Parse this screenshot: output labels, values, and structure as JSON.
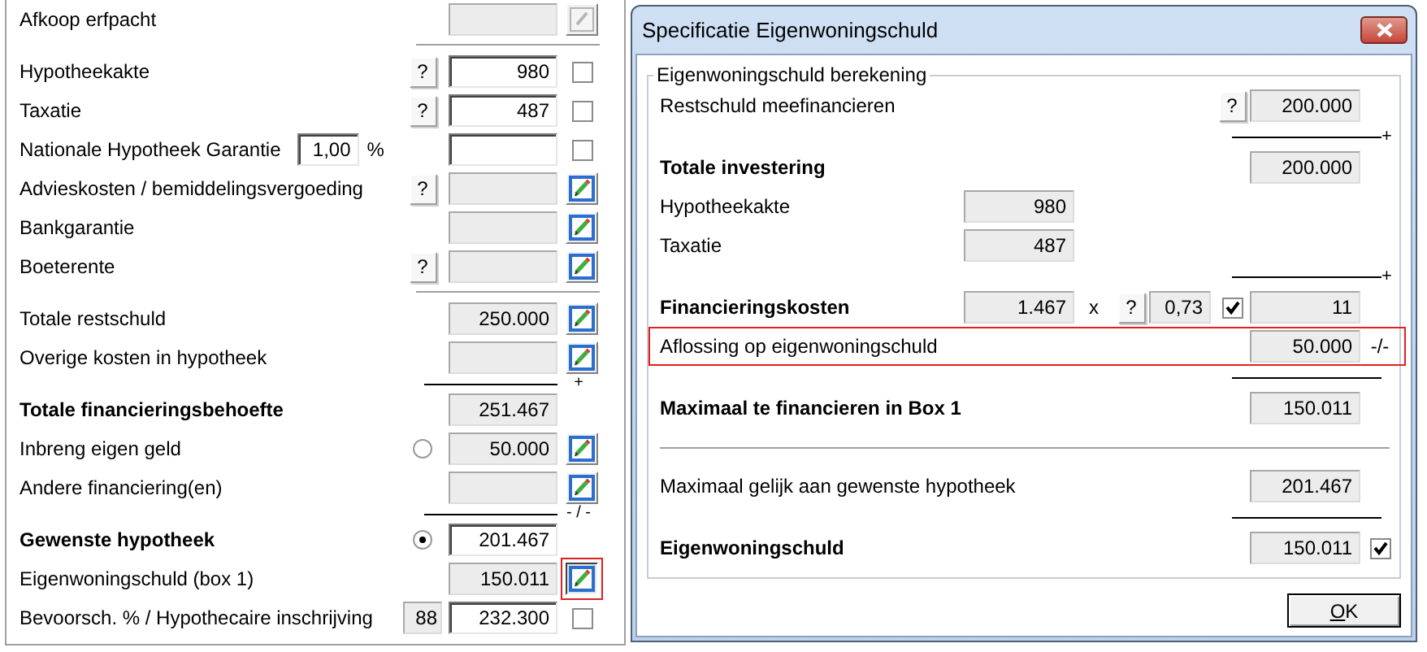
{
  "form": {
    "rows": [
      {
        "kind": "field",
        "label": "Afkoop erfpacht",
        "bold": false,
        "readonly": true,
        "action": {
          "disabled": true,
          "highlighted": false
        }
      },
      {
        "kind": "rule"
      },
      {
        "kind": "field",
        "label": "Hypotheekakte",
        "bold": false,
        "help": "?",
        "value": "980",
        "readonly": false,
        "checkbox": {
          "checked": false
        }
      },
      {
        "kind": "field",
        "label": "Taxatie",
        "bold": false,
        "help": "?",
        "value": "487",
        "readonly": false,
        "checkbox": {
          "checked": false
        }
      },
      {
        "kind": "field",
        "label": "Nationale Hypotheek Garantie",
        "bold": false,
        "inline": {
          "value": "1,00",
          "unit": "%"
        },
        "readonly": false,
        "checkbox": {
          "checked": false
        }
      },
      {
        "kind": "field",
        "label": "Advieskosten / bemiddelingsvergoeding",
        "bold": false,
        "help": "?",
        "readonly": true,
        "action": {
          "disabled": false,
          "highlighted": false
        }
      },
      {
        "kind": "field",
        "label": "Bankgarantie",
        "bold": false,
        "readonly": true,
        "action": {
          "disabled": false,
          "highlighted": false
        }
      },
      {
        "kind": "field",
        "label": "Boeterente",
        "bold": false,
        "help": "?",
        "readonly": true,
        "action": {
          "disabled": false,
          "highlighted": false
        }
      },
      {
        "kind": "rule"
      },
      {
        "kind": "field",
        "label": "Totale restschuld",
        "bold": false,
        "value": "250.000",
        "readonly": true,
        "action": {
          "disabled": false,
          "highlighted": false
        }
      },
      {
        "kind": "field",
        "label": "Overige kosten in hypotheek",
        "bold": false,
        "readonly": true,
        "action": {
          "disabled": false,
          "highlighted": false
        }
      },
      {
        "kind": "sum",
        "sign": "+"
      },
      {
        "kind": "field",
        "label": "Totale financieringsbehoefte",
        "bold": true,
        "value": "251.467",
        "readonly": true
      },
      {
        "kind": "field",
        "label": "Inbreng eigen geld",
        "bold": false,
        "option": {
          "selected": false
        },
        "value": "50.000",
        "readonly": true,
        "action": {
          "disabled": false,
          "highlighted": false
        }
      },
      {
        "kind": "field",
        "label": "Andere financiering(en)",
        "bold": false,
        "readonly": true,
        "action": {
          "disabled": false,
          "highlighted": false
        }
      },
      {
        "kind": "sum",
        "sign": "- / -"
      },
      {
        "kind": "field",
        "label": "Gewenste hypotheek",
        "bold": true,
        "option": {
          "selected": true
        },
        "value": "201.467",
        "readonly": false
      },
      {
        "kind": "field",
        "label": "Eigenwoningschuld (box 1)",
        "bold": false,
        "value": "150.011",
        "readonly": true,
        "action": {
          "disabled": false,
          "highlighted": true
        }
      },
      {
        "kind": "field",
        "label": "Bevoorsch. % / Hypothecaire inschrijving",
        "bold": false,
        "ratio": "88",
        "value": "232.300",
        "readonly": false,
        "checkbox": {
          "checked": false
        }
      }
    ]
  },
  "dialog": {
    "title": "Specificatie Eigenwoningschuld",
    "group": {
      "legend": "Eigenwoningschuld berekening",
      "rows": [
        {
          "kind": "field",
          "label": "Restschuld meefinancieren",
          "bold": false,
          "help": "?",
          "value": "200.000"
        },
        {
          "kind": "sum",
          "sign": "+"
        },
        {
          "kind": "field",
          "label": "Totale investering",
          "bold": true,
          "value": "200.000"
        },
        {
          "kind": "field",
          "label": "Hypotheekakte",
          "bold": false,
          "base": "980"
        },
        {
          "kind": "field",
          "label": "Taxatie",
          "bold": false,
          "base": "487"
        },
        {
          "kind": "sum",
          "sign": "+"
        },
        {
          "kind": "field",
          "label": "Financieringskosten",
          "bold": true,
          "base": "1.467",
          "operator": "x",
          "factor": {
            "help": "?",
            "value": "0,73",
            "checked": true
          },
          "value": "11"
        },
        {
          "kind": "field",
          "label": "Aflossing op eigenwoningschuld",
          "bold": false,
          "value": "50.000",
          "suffix": "-/-",
          "highlighted": true
        },
        {
          "kind": "sum"
        },
        {
          "kind": "field",
          "label": "Maximaal te financieren in Box 1",
          "bold": true,
          "value": "150.011"
        },
        {
          "kind": "rule"
        },
        {
          "kind": "field",
          "label": "Maximaal gelijk aan gewenste hypotheek",
          "bold": false,
          "value": "201.467"
        },
        {
          "kind": "sum"
        },
        {
          "kind": "field",
          "label": "Eigenwoningschuld",
          "bold": true,
          "value": "150.011",
          "checkbox": {
            "checked": true
          }
        }
      ]
    },
    "ok_button": "OK"
  }
}
